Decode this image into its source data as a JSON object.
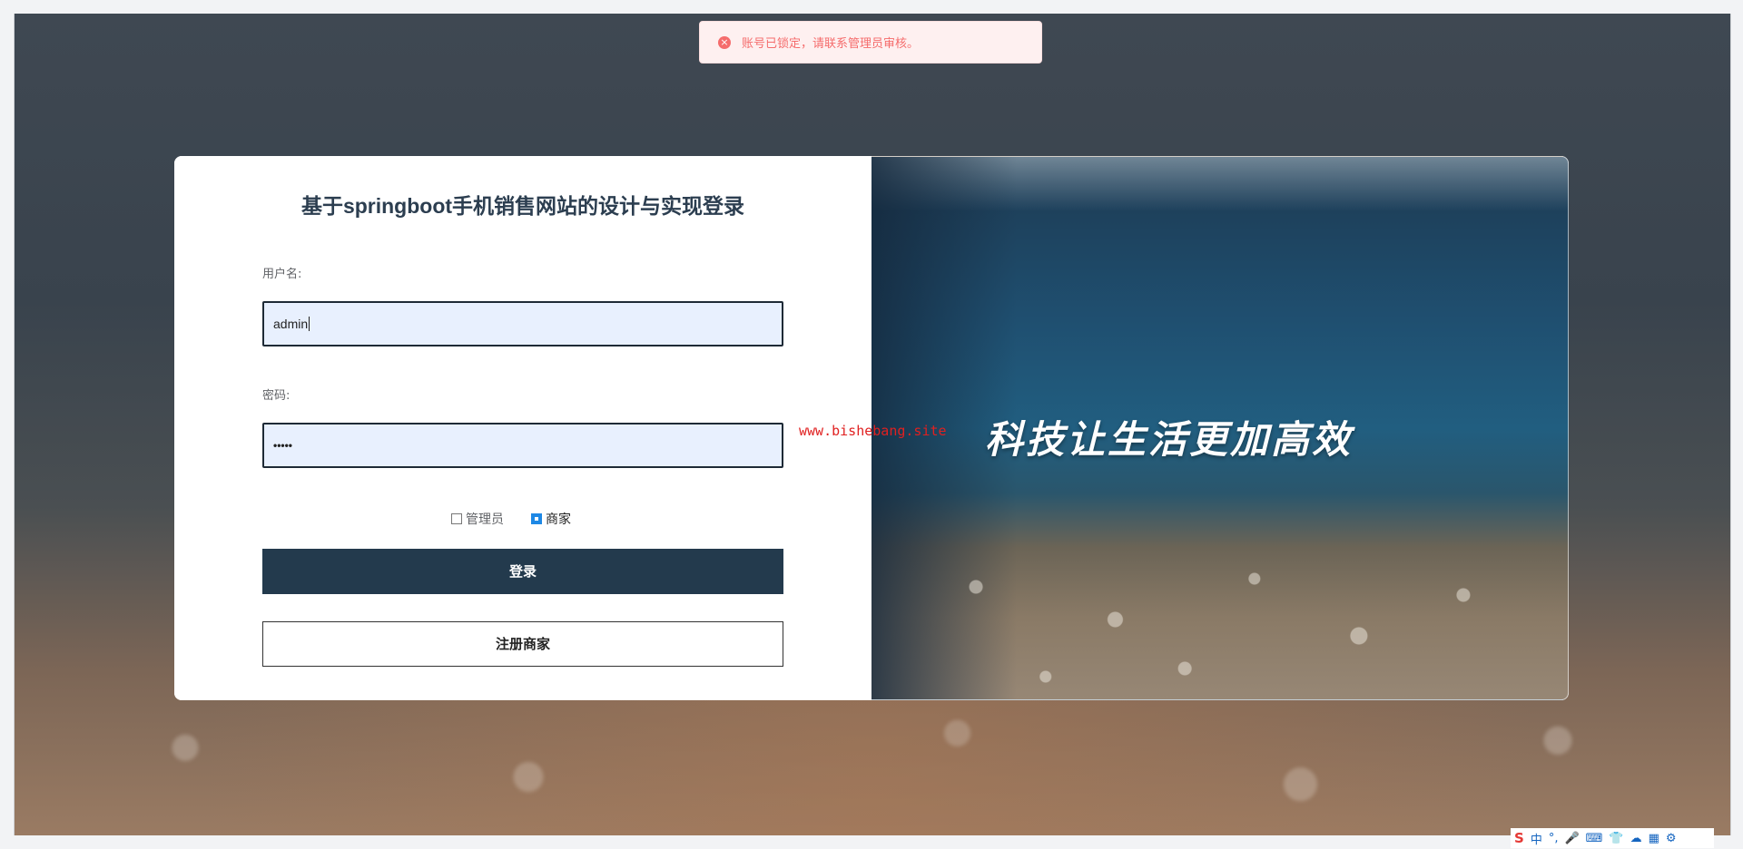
{
  "toast": {
    "icon": "error-circle-icon",
    "message": "账号已锁定，请联系管理员审核。"
  },
  "login": {
    "title": "基于springboot手机销售网站的设计与实现登录",
    "username_label": "用户名:",
    "username_value": "admin",
    "password_label": "密码:",
    "password_value": "•••••",
    "roles": [
      {
        "label": "管理员",
        "checked": false
      },
      {
        "label": "商家",
        "checked": true
      }
    ],
    "login_button": "登录",
    "register_button": "注册商家"
  },
  "banner": {
    "slogan": "科技让生活更加高效"
  },
  "watermark": "www.bishebang.site",
  "tray": {
    "items": [
      "S",
      "中",
      "°,",
      "🎤",
      "⌨",
      "👕",
      "☁",
      "▦",
      "⚙"
    ]
  }
}
